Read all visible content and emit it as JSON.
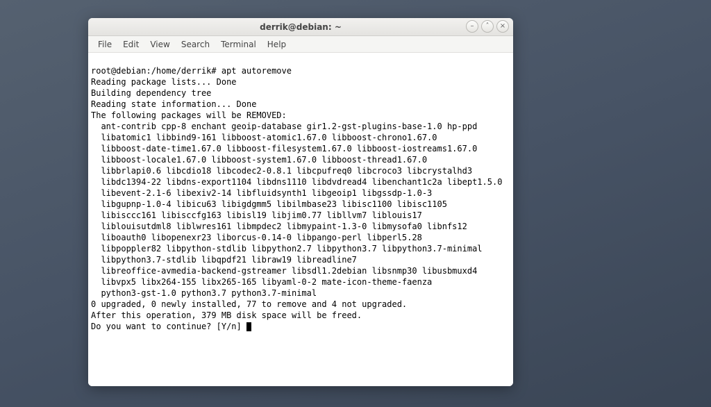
{
  "window": {
    "title": "derrik@debian: ~",
    "controls": {
      "minimize_glyph": "–",
      "maximize_glyph": "˄",
      "close_glyph": "×"
    }
  },
  "menubar": {
    "file": "File",
    "edit": "Edit",
    "view": "View",
    "search": "Search",
    "terminal": "Terminal",
    "help": "Help"
  },
  "terminal": {
    "lines": [
      "root@debian:/home/derrik# apt autoremove",
      "Reading package lists... Done",
      "Building dependency tree",
      "Reading state information... Done",
      "The following packages will be REMOVED:",
      "  ant-contrib cpp-8 enchant geoip-database gir1.2-gst-plugins-base-1.0 hp-ppd",
      "  libatomic1 libbind9-161 libboost-atomic1.67.0 libboost-chrono1.67.0",
      "  libboost-date-time1.67.0 libboost-filesystem1.67.0 libboost-iostreams1.67.0",
      "  libboost-locale1.67.0 libboost-system1.67.0 libboost-thread1.67.0",
      "  libbrlapi0.6 libcdio18 libcodec2-0.8.1 libcpufreq0 libcroco3 libcrystalhd3",
      "  libdc1394-22 libdns-export1104 libdns1110 libdvdread4 libenchant1c2a libept1.5.0",
      "  libevent-2.1-6 libexiv2-14 libfluidsynth1 libgeoip1 libgssdp-1.0-3",
      "  libgupnp-1.0-4 libicu63 libigdgmm5 libilmbase23 libisc1100 libisc1105",
      "  libisccc161 libisccfg163 libisl19 libjim0.77 libllvm7 liblouis17",
      "  liblouisutdml8 liblwres161 libmpdec2 libmypaint-1.3-0 libmysofa0 libnfs12",
      "  liboauth0 libopenexr23 liborcus-0.14-0 libpango-perl libperl5.28",
      "  libpoppler82 libpython-stdlib libpython2.7 libpython3.7 libpython3.7-minimal",
      "  libpython3.7-stdlib libqpdf21 libraw19 libreadline7",
      "  libreoffice-avmedia-backend-gstreamer libsdl1.2debian libsnmp30 libusbmuxd4",
      "  libvpx5 libx264-155 libx265-165 libyaml-0-2 mate-icon-theme-faenza",
      "  python3-gst-1.0 python3.7 python3.7-minimal",
      "0 upgraded, 0 newly installed, 77 to remove and 4 not upgraded.",
      "After this operation, 379 MB disk space will be freed.",
      "Do you want to continue? [Y/n] "
    ]
  }
}
